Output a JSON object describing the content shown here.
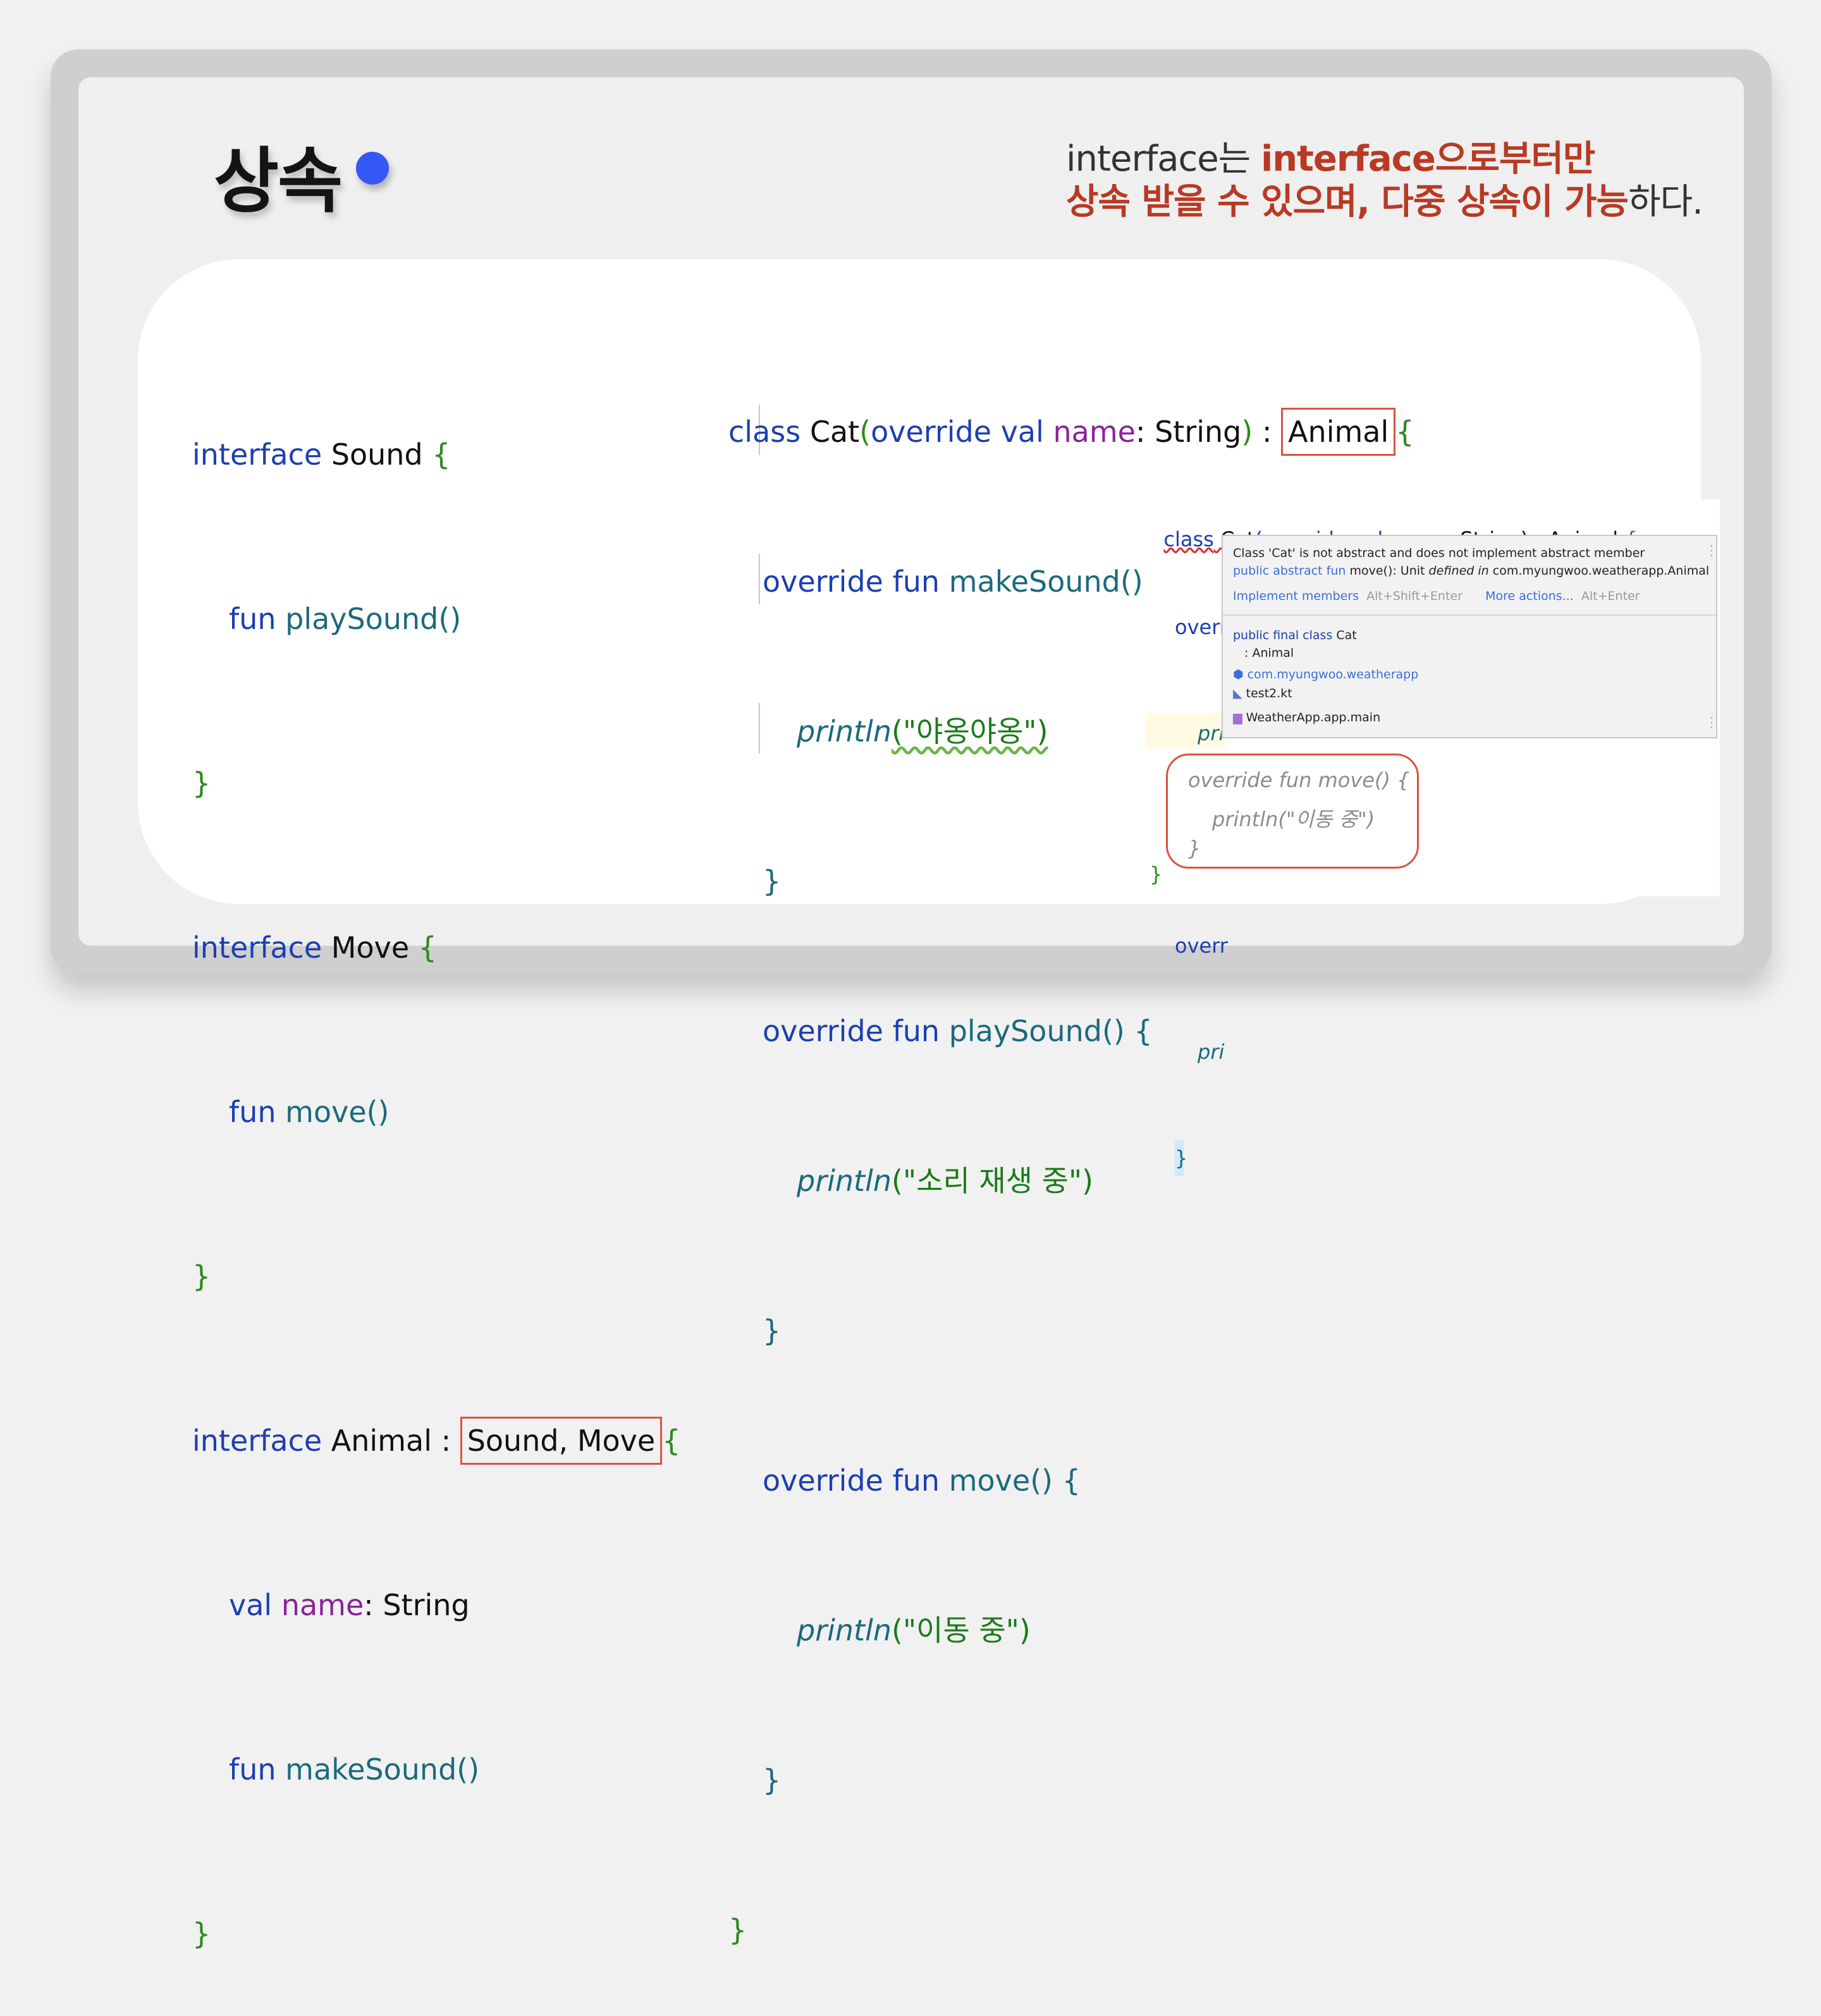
{
  "title": "상속",
  "subtitle": {
    "l1_a": "interface는 ",
    "l1_b": "interface으로부터만",
    "l2_a": "상속 받을 수 있으며, 다중 상속이 가능",
    "l2_b": "하다."
  },
  "left_code": {
    "sound_kw": "interface",
    "sound_name": " Sound ",
    "open": "{",
    "close": "}",
    "fun": "fun",
    "play_sound": " playSound()",
    "move_name": " Move ",
    "move_fn": " move()",
    "animal_name": " Animal : ",
    "animal_parents": "Sound, Move",
    "val": "val",
    "name_prop": " name",
    "name_type": ": String",
    "make_sound": " makeSound()"
  },
  "mid_code": {
    "class_kw": "class",
    "cat": " Cat",
    "paren_open": "(",
    "override_val": "override val",
    "name": " name",
    "string": ": String",
    "paren_close": ")",
    "colon": " : ",
    "animal": "Animal",
    "brace": "{",
    "override_fun": "override fun",
    "make_sound": " makeSound() {",
    "println": "println",
    "meow": "(\"야옹야옹\")",
    "close": "}",
    "play_sound": " playSound() {",
    "sound_play": "(\"소리 재생 중\")",
    "move": " move() {",
    "moving": "(\"이동 중\")"
  },
  "ide": {
    "header_a": "class",
    "header_b": " Cat",
    "header_c": "(override val",
    "header_d": " name",
    "header_e": ": String) : Animal ",
    "header_f": "{",
    "over1": "overr",
    "pri1": "pri",
    "close1": "}",
    "over2": "overr",
    "pri2": "pri",
    "close2": "}",
    "close_final": "}",
    "popup": {
      "msg": "Class 'Cat' is not abstract and does not implement abstract member",
      "sig_a": "public abstract fun",
      "sig_b": " move(): Unit ",
      "sig_c": "defined in",
      "sig_d": " com.myungwoo.weatherapp.Animal",
      "action1": "Implement members",
      "shortcut1": "Alt+Shift+Enter",
      "action2": "More actions...",
      "shortcut2": "Alt+Enter",
      "decl_a": "public final class",
      "decl_b": " Cat",
      "decl_super": ": Animal",
      "pkg": "com.myungwoo.weatherapp",
      "file": "test2.kt",
      "module": "WeatherApp.app.main"
    },
    "suggest": {
      "l1": "override fun move() {",
      "l2": "println(\"이동 중\")",
      "l3": "}"
    }
  },
  "colors": {
    "accent_red": "#b83a24",
    "dot_blue": "#3557f5",
    "box_border": "#d9533d"
  }
}
